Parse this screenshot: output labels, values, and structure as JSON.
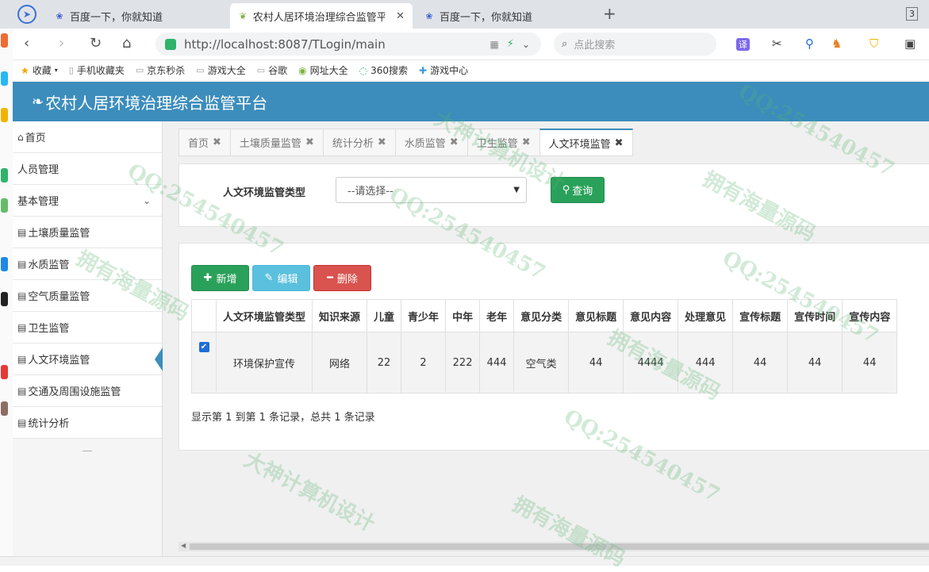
{
  "browser": {
    "tabs": [
      {
        "title": "百度一下，你就知道",
        "active": false
      },
      {
        "title": "农村人居环境治理综合监管平台",
        "active": true
      },
      {
        "title": "百度一下，你就知道",
        "active": false
      }
    ],
    "new_tab": "+",
    "tab_count": "3",
    "url": "http://localhost:8087/TLogin/main",
    "search_placeholder": "点此搜索",
    "bookmarks": [
      "收藏",
      "手机收藏夹",
      "京东秒杀",
      "游戏大全",
      "谷歌",
      "网址大全",
      "360搜索",
      "游戏中心"
    ]
  },
  "app": {
    "title": "农村人居环境治理综合监管平台"
  },
  "sidebar": {
    "items": [
      {
        "label": "首页",
        "icon": "home-icon"
      },
      {
        "label": "人员管理",
        "icon": ""
      },
      {
        "label": "基本管理",
        "icon": "",
        "chevron": true
      },
      {
        "label": "土壤质量监管",
        "icon": "list-icon"
      },
      {
        "label": "水质监管",
        "icon": "list-icon"
      },
      {
        "label": "空气质量监管",
        "icon": "list-icon"
      },
      {
        "label": "卫生监管",
        "icon": "list-icon"
      },
      {
        "label": "人文环境监管",
        "icon": "list-icon",
        "active": true
      },
      {
        "label": "交通及周围设施监管",
        "icon": "list-icon"
      },
      {
        "label": "统计分析",
        "icon": "list-icon"
      }
    ],
    "footer": "—"
  },
  "page_tabs": [
    {
      "label": "首页"
    },
    {
      "label": "土壤质量监管"
    },
    {
      "label": "统计分析"
    },
    {
      "label": "水质监管"
    },
    {
      "label": "卫生监管"
    },
    {
      "label": "人文环境监管",
      "active": true
    }
  ],
  "filter": {
    "label": "人文环境监管类型",
    "select_value": "--请选择--",
    "query_label": "查询"
  },
  "actions": {
    "add": "新增",
    "edit": "编辑",
    "delete": "删除"
  },
  "table": {
    "columns": [
      "人文环境监管类型",
      "知识来源",
      "儿童",
      "青少年",
      "中年",
      "老年",
      "意见分类",
      "意见标题",
      "意见内容",
      "处理意见",
      "宣传标题",
      "宣传时间",
      "宣传内容"
    ],
    "rows": [
      [
        "环境保护宣传",
        "网络",
        "22",
        "2",
        "222",
        "444",
        "空气类",
        "44",
        "4444",
        "444",
        "44",
        "44",
        "44"
      ]
    ]
  },
  "pager": {
    "info": "显示第 1 到第 1 条记录，总共 1 条记录"
  },
  "watermark": [
    "QQ:254540457",
    "拥有海量源码",
    "大神计算机设计"
  ],
  "colors": {
    "header": "#3c8dbc",
    "success": "#2aa15a",
    "info": "#5bc0de",
    "danger": "#d9534f"
  }
}
